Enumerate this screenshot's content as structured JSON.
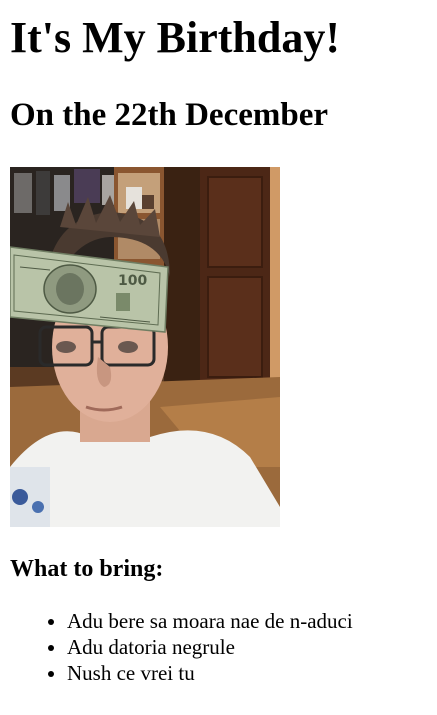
{
  "header": {
    "title": "It's My Birthday!",
    "subtitle": "On the 22th December"
  },
  "photo": {
    "icon": "birthday-selfie-photo"
  },
  "bring": {
    "heading": "What to bring:",
    "items": [
      "Adu bere sa moara nae de n-aduci",
      "Adu datoria negrule",
      "Nush ce vrei tu"
    ]
  }
}
